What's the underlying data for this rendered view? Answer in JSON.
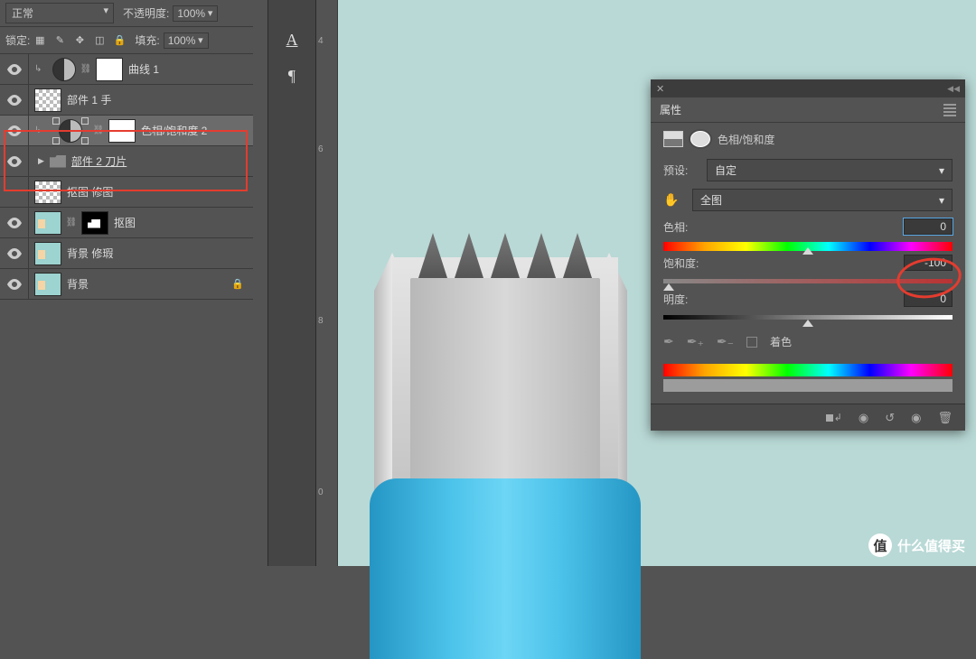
{
  "layers_panel": {
    "blend_mode": "正常",
    "opacity_label": "不透明度:",
    "opacity_value": "100%",
    "lock_label": "锁定:",
    "fill_label": "填充:",
    "fill_value": "100%",
    "items": [
      {
        "name": "曲线 1",
        "type": "adjustment",
        "clipped": true,
        "hasMask": true
      },
      {
        "name": "部件 1 手",
        "type": "raster"
      },
      {
        "name": "色相/饱和度 2",
        "type": "adjustment",
        "corners": true,
        "clipped": true,
        "hasMask": true,
        "selected": true
      },
      {
        "name": "部件 2 刀片",
        "type": "folder",
        "underline": true
      },
      {
        "name": "抠图 修图",
        "type": "raster"
      },
      {
        "name": "抠图",
        "type": "photo",
        "blackmask": true
      },
      {
        "name": "背景 修瑕",
        "type": "photo"
      },
      {
        "name": "背景",
        "type": "photo",
        "locked": true
      }
    ]
  },
  "type_panel": {
    "char": "A",
    "pilcrow": "¶"
  },
  "ruler": {
    "ticks": [
      "4",
      "6",
      "8",
      "0"
    ]
  },
  "properties": {
    "panel_title": "属性",
    "adj_label": "色相/饱和度",
    "preset_label": "预设:",
    "preset_value": "自定",
    "range_value": "全图",
    "hue_label": "色相:",
    "hue_value": "0",
    "sat_label": "饱和度:",
    "sat_value": "-100",
    "light_label": "明度:",
    "light_value": "0",
    "colorize_label": "着色"
  },
  "watermark": {
    "badge": "值",
    "text": "什么值得买"
  }
}
